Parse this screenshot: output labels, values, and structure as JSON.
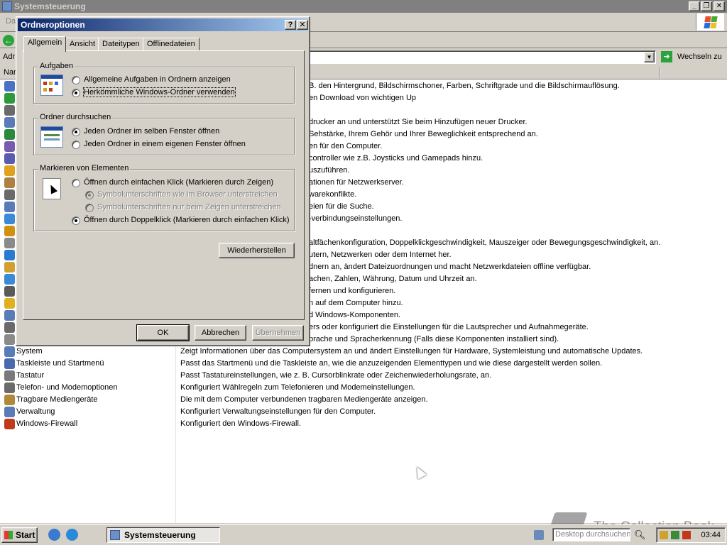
{
  "window": {
    "title": "Systemsteuerung",
    "menu_partial": "Da",
    "addr_partial": "Adr",
    "go_label": "Wechseln zu"
  },
  "columns": {
    "name_partial": "Nan"
  },
  "rows": [
    {
      "desc": "B. den Hintergrund, Bildschirmschoner, Farben, Schriftgrade und die Bildschirmauflösung.",
      "color": "#4a72c4"
    },
    {
      "desc": "en Download von wichtigen Up",
      "color": "#2a9a3a"
    },
    {
      "desc": "",
      "color": "#6a6a6a"
    },
    {
      "desc": "drucker an und unterstützt Sie beim Hinzufügen neuer Drucker.",
      "color": "#5a7ab8"
    },
    {
      "desc": "Sehstärke, Ihrem Gehör und Ihrer Beweglichkeit entsprechend an.",
      "color": "#2a8a3a"
    },
    {
      "desc": "en für den Computer.",
      "color": "#7a5ab0"
    },
    {
      "desc": "controller wie z.B. Joysticks und Gamepads hinzu.",
      "color": "#5a5ab0"
    },
    {
      "desc": "uszuführen.",
      "color": "#e0a020"
    },
    {
      "desc": "ationen für Netzwerkserver.",
      "color": "#b08040"
    },
    {
      "desc": "warekonflikte.",
      "color": "#6a6a6a"
    },
    {
      "desc": "eien für die Suche.",
      "color": "#5a7ab8"
    },
    {
      "desc": "-verbindungseinstellungen.",
      "color": "#3a8ad8"
    },
    {
      "desc": "",
      "color": "#d09010"
    },
    {
      "desc": "altfächenkonfiguration, Doppelklickgeschwindigkeit, Mauszeiger oder Bewegungsgeschwindigkeit, an.",
      "color": "#8a8a8a"
    },
    {
      "desc": "utern, Netzwerken oder dem Internet her.",
      "color": "#2a7ad0"
    },
    {
      "desc": "dnern an, ändert Dateizuordnungen und macht Netzwerkdateien offline verfügbar.",
      "color": "#d0a030"
    },
    {
      "desc": "achen, Zahlen, Währung, Datum und Uhrzeit an.",
      "color": "#3a8ad8"
    },
    {
      "desc": "fernen und konfigurieren.",
      "color": "#5a5a5a"
    },
    {
      "desc": "n auf dem Computer hinzu.",
      "color": "#e0b020"
    },
    {
      "desc": "d Windows-Komponenten.",
      "color": "#5a7ab8"
    },
    {
      "desc": "ers oder konfiguriert die Einstellungen für die Lautsprecher und Aufnahmegeräte.",
      "color": "#6a6a6a"
    },
    {
      "desc": "prache und Spracherkennung (Falls diese Komponenten installiert sind).",
      "color": "#8a8a8a"
    }
  ],
  "full_rows": [
    {
      "name": "System",
      "desc": "Zeigt Informationen über das Computersystem an und ändert Einstellungen für Hardware, Systemleistung und automatische Updates.",
      "color": "#5a7ab8"
    },
    {
      "name": "Taskleiste und Startmenü",
      "desc": "Passt das Startmenü und die Taskleiste an, wie die anzuzeigenden Elementtypen und wie diese dargestellt werden sollen.",
      "color": "#4a6ab0"
    },
    {
      "name": "Tastatur",
      "desc": "Passt Tastatureinstellungen, wie z. B. Cursorblinkrate oder Zeichenwiederholungsrate, an.",
      "color": "#7a7a7a"
    },
    {
      "name": "Telefon- und Modemoptionen",
      "desc": "Konfiguriert Wählregeln zum Telefonieren und Modemeinstellungen.",
      "color": "#6a6a6a"
    },
    {
      "name": "Tragbare Mediengeräte",
      "desc": "Die mit dem Computer verbundenen tragbaren Mediengeräte anzeigen.",
      "color": "#b08a3a"
    },
    {
      "name": "Verwaltung",
      "desc": "Konfiguriert Verwaltungseinstellungen für den Computer.",
      "color": "#5a7ab8"
    },
    {
      "name": "Windows-Firewall",
      "desc": "Konfiguriert den Windows-Firewall.",
      "color": "#c03a1a"
    }
  ],
  "dialog": {
    "title": "Ordneroptionen",
    "help": "?",
    "close": "✕",
    "tabs": [
      "Allgemein",
      "Ansicht",
      "Dateitypen",
      "Offlinedateien"
    ],
    "active_tab": "Allgemein",
    "groups": {
      "tasks": {
        "legend": "Aufgaben",
        "option1": "Allgemeine Aufgaben in Ordnern anzeigen",
        "option2": "Herkömmliche Windows-Ordner verwenden",
        "selected": 2
      },
      "browse": {
        "legend": "Ordner durchsuchen",
        "option1": "Jeden Ordner im selben Fenster öffnen",
        "option2": "Jeden Ordner in einem eigenen Fenster öffnen",
        "selected": 1
      },
      "click": {
        "legend": "Markieren von Elementen",
        "option1": "Öffnen durch einfachen Klick (Markieren durch Zeigen)",
        "sub1": "Symbolunterschriften wie im Browser unterstreichen",
        "sub2": "Symbolunterschriften nur beim Zeigen unterstreichen",
        "option2": "Öffnen durch Doppelklick (Markieren durch einfachen Klick)",
        "selected": 2
      }
    },
    "restore_label": "Wiederherstellen",
    "ok_label": "OK",
    "cancel_label": "Abbrechen",
    "apply_label": "Übernehmen"
  },
  "taskbar": {
    "start_label": "Start",
    "task_label": "Systemsteuerung",
    "search_placeholder": "Desktop durchsuchen",
    "clock": "03:44"
  },
  "watermark": "The Collection Book"
}
